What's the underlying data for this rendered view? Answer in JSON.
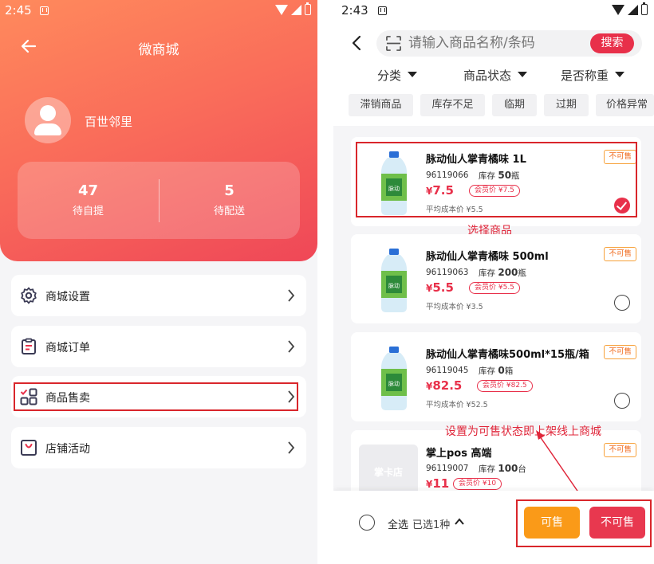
{
  "left": {
    "status": {
      "time": "2:45"
    },
    "header": {
      "title": "微商城"
    },
    "profile": {
      "shop_name": "百世邻里"
    },
    "stats": [
      {
        "value": "47",
        "label": "待自提"
      },
      {
        "value": "5",
        "label": "待配送"
      }
    ],
    "menu": [
      {
        "label": "商城设置",
        "icon": "gear-icon"
      },
      {
        "label": "商城订单",
        "icon": "clipboard-icon"
      },
      {
        "label": "商品售卖",
        "icon": "grid-check-icon"
      },
      {
        "label": "店铺活动",
        "icon": "shop-bag-icon"
      }
    ]
  },
  "right": {
    "status": {
      "time": "2:43"
    },
    "search": {
      "placeholder": "请输入商品名称/条码",
      "button": "搜索"
    },
    "filters": [
      "分类",
      "商品状态",
      "是否称重"
    ],
    "tags": [
      "滞销商品",
      "库存不足",
      "临期",
      "过期",
      "价格异常"
    ],
    "products": [
      {
        "name": "脉动仙人掌青橘味 1L",
        "code": "96119066",
        "stock_label": "库存",
        "stock": "50",
        "unit": "瓶",
        "currency": "¥",
        "price": "7.5",
        "member_price": "会员价 ¥7.5",
        "avg_cost": "平均成本价 ¥5.5",
        "status": "不可售",
        "checked": true,
        "image": "bottle"
      },
      {
        "name": "脉动仙人掌青橘味 500ml",
        "code": "96119063",
        "stock_label": "库存",
        "stock": "200",
        "unit": "瓶",
        "currency": "¥",
        "price": "5.5",
        "member_price": "会员价 ¥5.5",
        "avg_cost": "平均成本价 ¥3.5",
        "status": "不可售",
        "checked": false,
        "image": "bottle"
      },
      {
        "name": "脉动仙人掌青橘味500ml*15瓶/箱",
        "code": "96119045",
        "stock_label": "库存",
        "stock": "0",
        "unit": "箱",
        "currency": "¥",
        "price": "82.5",
        "member_price": "会员价 ¥82.5",
        "avg_cost": "平均成本价 ¥52.5",
        "status": "不可售",
        "checked": false,
        "image": "bottle"
      },
      {
        "name": "掌上pos 高端",
        "code": "96119007",
        "stock_label": "库存",
        "stock": "100",
        "unit": "台",
        "currency": "¥",
        "price": "11",
        "member_price": "会员价 ¥10",
        "avg_cost": "",
        "status": "不可售",
        "checked": false,
        "image": "placeholder",
        "placeholder_text": "掌卡店"
      }
    ],
    "annotations": {
      "select": "选择商品",
      "hint": "设置为可售状态即上架线上商城"
    },
    "bottom": {
      "select_all": "全选",
      "selected_count": "已选1种",
      "sell": "可售",
      "unsell": "不可售"
    },
    "colors": {
      "accent": "#e8304a",
      "orange": "#fa9a18",
      "annotation_red": "#d9262b"
    }
  }
}
